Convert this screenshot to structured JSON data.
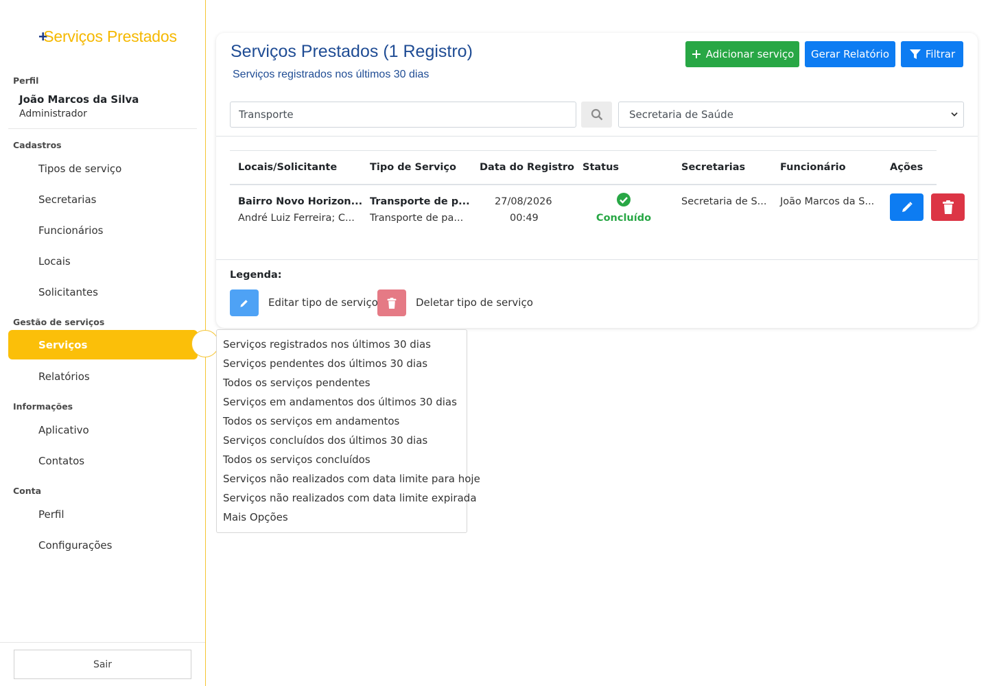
{
  "sidebar": {
    "brand": "Serviços Prestados",
    "profile_label": "Perfil",
    "user_name": "João Marcos da Silva",
    "user_role": "Administrador",
    "sections": {
      "cadastros": "Cadastros",
      "gestao": "Gestão de serviços",
      "informacoes": "Informações",
      "conta": "Conta"
    },
    "items": {
      "tipos": "Tipos de serviço",
      "secretarias": "Secretarias",
      "funcionarios": "Funcionários",
      "locais": "Locais",
      "solicitantes": "Solicitantes",
      "servicos": "Serviços",
      "relatorios": "Relatórios",
      "aplicativo": "Aplicativo",
      "contatos": "Contatos",
      "perfil": "Perfil",
      "configuracoes": "Configurações"
    },
    "logout": "Sair",
    "accent_color": "#fbbf09"
  },
  "main": {
    "title": "Serviços Prestados (1 Registro)",
    "subtitle": "Serviços registrados nos últimos 30 dias",
    "buttons": {
      "add": "Adicionar serviço",
      "report": "Gerar Relatório",
      "filter": "Filtrar"
    },
    "search_value": "Transporte",
    "select_value": "Secretaria de Saúde",
    "table": {
      "headers": {
        "locais": "Locais/Solicitante",
        "tipo": "Tipo de Serviço",
        "data": "Data do Registro",
        "status": "Status",
        "secretarias": "Secretarias",
        "funcionario": "Funcionário",
        "acoes": "Ações"
      },
      "row": {
        "local": "Bairro Novo Horizon...",
        "solicitante": "André Luiz Ferreira; C...",
        "tipo_bold": "Transporte de p...",
        "tipo": "Transporte de pa...",
        "date": "27/08/2026",
        "time": "00:49",
        "status": "Concluído",
        "secretaria": "Secretaria de S...",
        "funcionario": "João Marcos da S..."
      }
    },
    "legend": {
      "title": "Legenda:",
      "edit": "Editar tipo de serviço",
      "delete": "Deletar tipo de serviço"
    }
  },
  "dropdown": {
    "items": [
      "Serviços registrados nos últimos 30 dias",
      "Serviços pendentes dos últimos 30 dias",
      "Todos os serviços pendentes",
      "Serviços em andamentos dos últimos 30 dias",
      "Todos os serviços em andamentos",
      "Serviços concluídos dos últimos 30 dias",
      "Todos os serviços concluídos",
      "Serviços não realizados com data limite para hoje",
      "Serviços não realizados com data limite expirada",
      "Mais Opções"
    ]
  }
}
